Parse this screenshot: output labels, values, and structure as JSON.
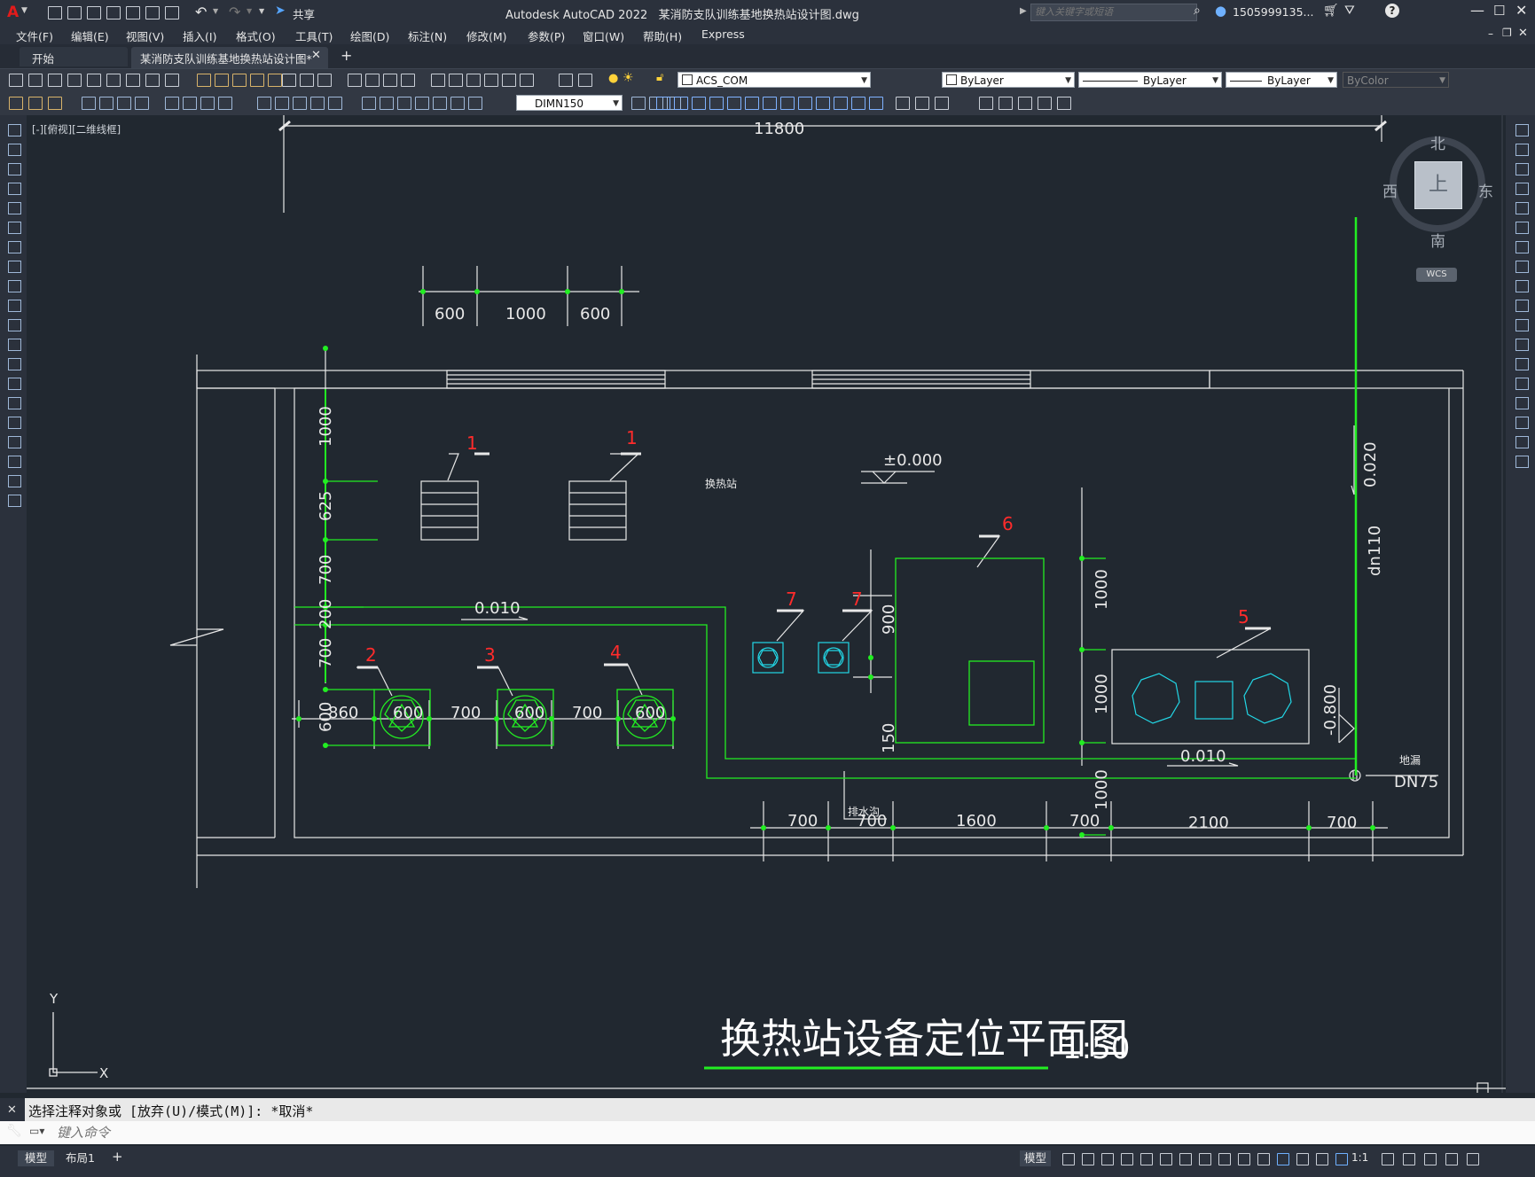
{
  "titlebar": {
    "app_title": "Autodesk AutoCAD 2022",
    "file_name": "某消防支队训练基地换热站设计图.dwg",
    "share_label": "共享",
    "search_placeholder": "键入关键字或短语",
    "user_name": "1505999135...",
    "icons": [
      "autocad-logo-icon",
      "new-icon",
      "open-icon",
      "save-icon",
      "saveas-icon",
      "open-from-web-icon",
      "save-to-web-icon",
      "plot-icon",
      "undo-icon",
      "redo-icon",
      "share-icon",
      "search-icon",
      "user-icon",
      "cart-icon",
      "autodesk-app-icon",
      "help-icon",
      "minimize-icon",
      "maximize-icon",
      "close-icon"
    ]
  },
  "menubar": {
    "items": [
      "文件(F)",
      "编辑(E)",
      "视图(V)",
      "插入(I)",
      "格式(O)",
      "工具(T)",
      "绘图(D)",
      "标注(N)",
      "修改(M)",
      "参数(P)",
      "窗口(W)",
      "帮助(H)",
      "Express"
    ]
  },
  "tabs": {
    "start": "开始",
    "active": "某消防支队训练基地换热站设计图*"
  },
  "toolbar": {
    "layer_name": "ACS_COM",
    "color": "ByLayer",
    "linetype": "ByLayer",
    "lineweight": "ByLayer",
    "plotstyle": "ByColor",
    "dimstyle": "DIMN150"
  },
  "viewport": {
    "label": "[-][俯视][二维线框]",
    "viewcube": {
      "north": "北",
      "south": "南",
      "east": "东",
      "west": "西",
      "face": "上",
      "wcs": "WCS"
    },
    "ucs": {
      "x": "X",
      "y": "Y"
    }
  },
  "drawing": {
    "dims_top": [
      "11800"
    ],
    "dims_upper": [
      "600",
      "1000",
      "600"
    ],
    "dims_left": [
      "1000",
      "625",
      "700",
      "200",
      "700",
      "600"
    ],
    "dims_bottom_left": [
      "860",
      "600",
      "700",
      "600",
      "700",
      "600"
    ],
    "dims_mid": [
      "900",
      "150"
    ],
    "dims_right_vertical": [
      "1000",
      "1000",
      "1000"
    ],
    "dims_bottom_right": [
      "700",
      "700",
      "1600",
      "700",
      "2100",
      "700"
    ],
    "equipment_tags": [
      "1",
      "1",
      "2",
      "3",
      "4",
      "5",
      "6",
      "7",
      "7"
    ],
    "elevation": "±0.000",
    "room_label": "换热站",
    "slope_1": "0.010",
    "slope_2": "0.010",
    "slope_3": "0.020",
    "pipe_dn110": "dn110",
    "floor_level": "-0.800",
    "drain_label": "排水沟",
    "floor_drain": "地漏",
    "pipe_dn75": "DN75",
    "title": "换热站设备定位平面图",
    "scale": "1:50"
  },
  "commandline": {
    "history": "选择注释对象或 [放弃(U)/模式(M)]: *取消*",
    "placeholder": "键入命令"
  },
  "statusbar": {
    "layout_tabs": [
      "模型",
      "布局1"
    ],
    "model_label": "模型",
    "scale": "1:1"
  },
  "colors": {
    "canvas_bg": "#212830",
    "line_white": "#e8e8e8",
    "line_green": "#22ee22",
    "line_cyan": "#22d7e6",
    "tag_red": "#ff2b2b"
  }
}
